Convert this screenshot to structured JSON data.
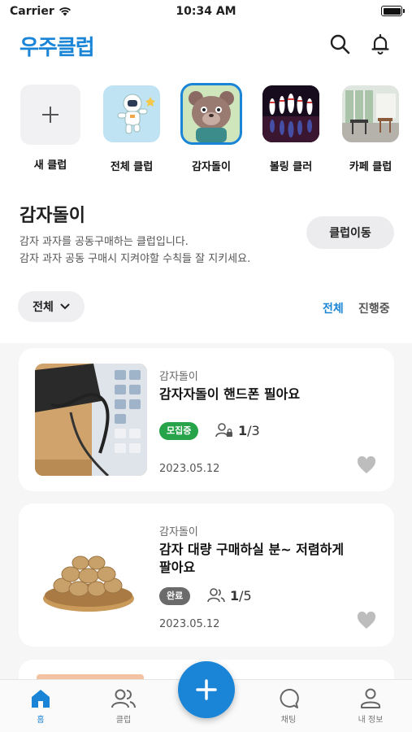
{
  "status": {
    "carrier": "Carrier",
    "time": "10:34 AM"
  },
  "header": {
    "logo": "우주클럽"
  },
  "clubs": [
    {
      "label": "새 클럽",
      "icon": "plus-icon"
    },
    {
      "label": "전체 클럽",
      "icon": "astronaut-image"
    },
    {
      "label": "감자돌이",
      "icon": "bear-character-image"
    },
    {
      "label": "볼링 클러",
      "icon": "bowling-pins-image"
    },
    {
      "label": "카페 클럽",
      "icon": "cafe-interior-image"
    }
  ],
  "club_info": {
    "title": "감자돌이",
    "desc_line1": "감자 과자를 공동구매하는 클럽입니다.",
    "desc_line2": "감자 과자 공동 구매시 지켜야할 수칙들 잘 지키세요.",
    "move_label": "클럽이동"
  },
  "filter": {
    "selected": "전체",
    "tabs": [
      "전체",
      "진행중"
    ]
  },
  "posts": [
    {
      "club": "감자돌이",
      "title_line1": "감자자돌이 핸드폰 필아요",
      "title_line2": "",
      "status": "모집중",
      "status_color": "#27a34a",
      "member_current": "1",
      "member_total": "/3",
      "date": "2023.05.12"
    },
    {
      "club": "감자돌이",
      "title_line1": "감자 대량 구매하실 분~ 저렴하게",
      "title_line2": "팔아요",
      "status": "완료",
      "status_color": "#6b6b6b",
      "member_current": "1",
      "member_total": "/5",
      "date": "2023.05.12"
    }
  ],
  "tabbar": {
    "home": "홈",
    "club": "클럽",
    "chat": "채팅",
    "profile": "내 정보"
  },
  "colors": {
    "accent": "#1a85d6",
    "recruiting": "#27a34a",
    "done": "#6b6b6b"
  }
}
